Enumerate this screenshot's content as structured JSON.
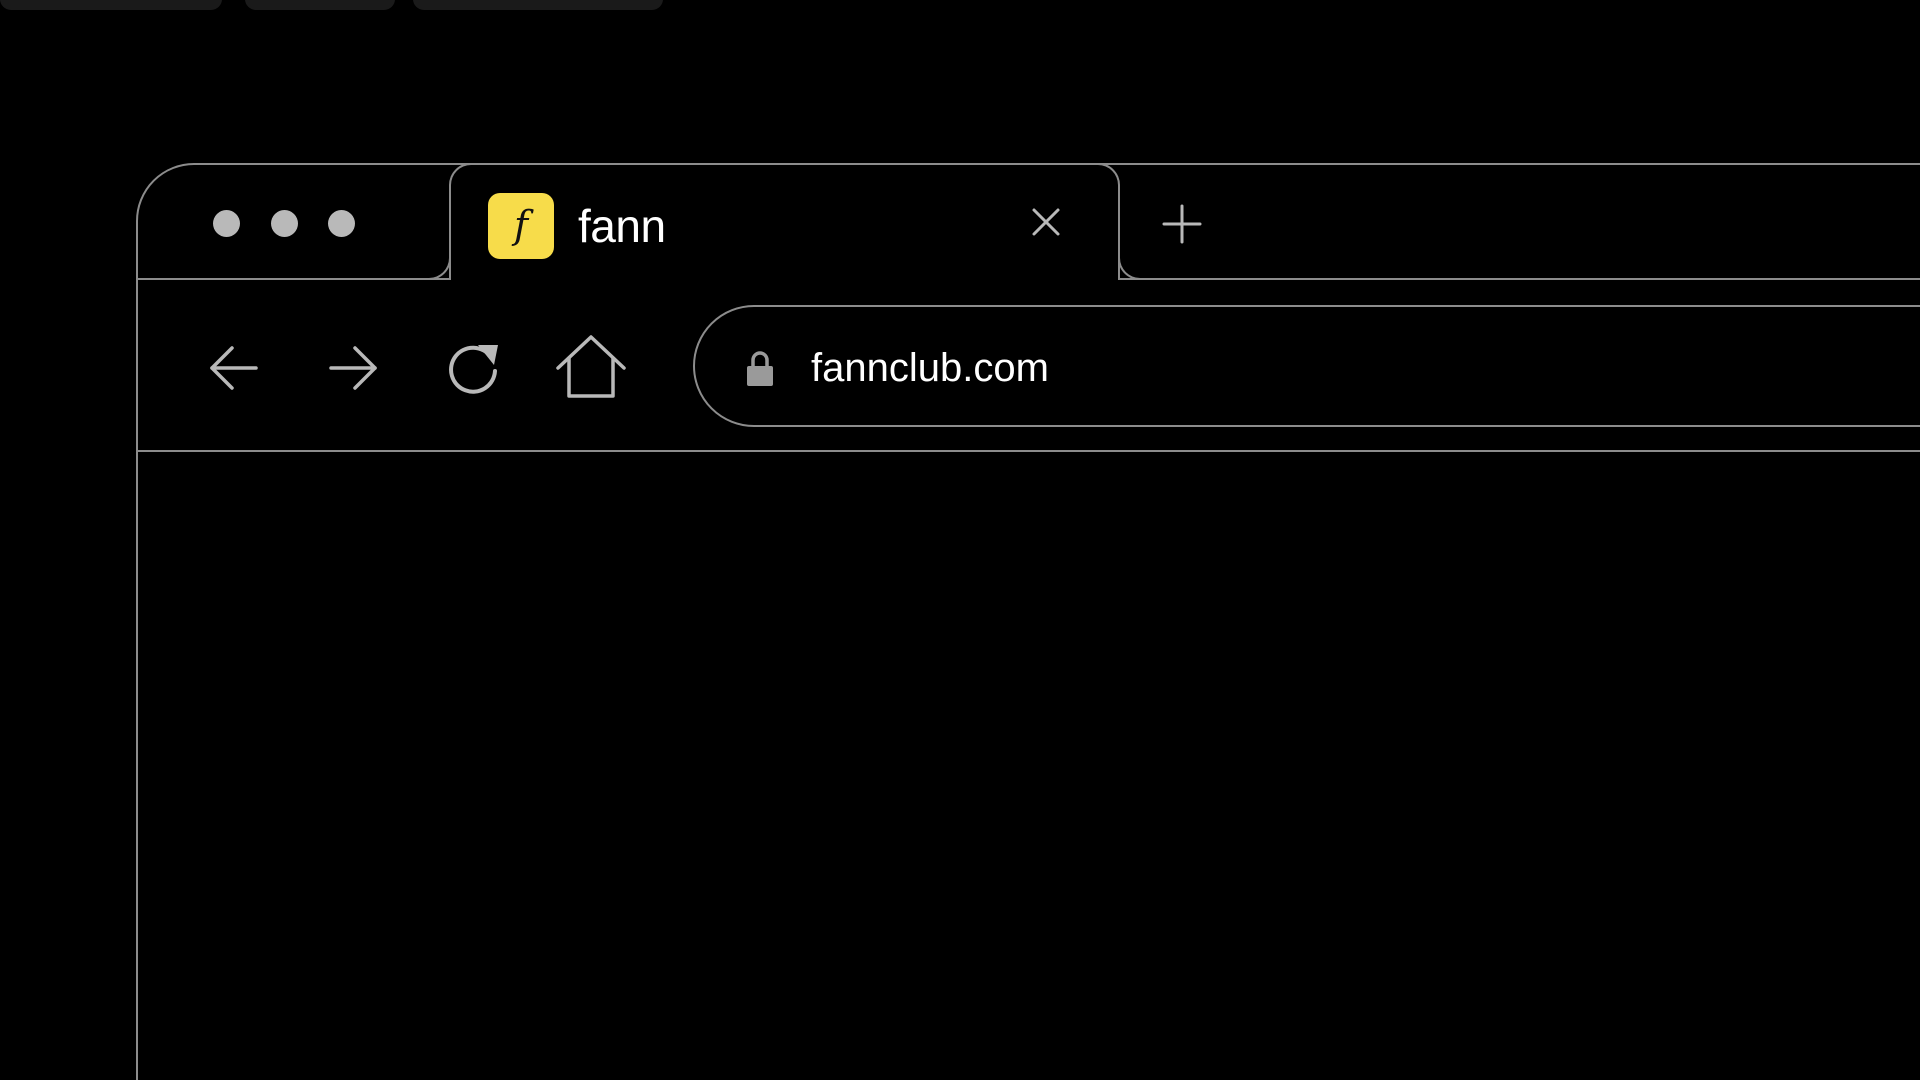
{
  "tab": {
    "title": "fann",
    "favicon_letter": "f",
    "favicon_color": "#f7dc4a",
    "close_icon": "close-icon"
  },
  "toolbar": {
    "new_tab_icon": "plus-icon",
    "back_icon": "arrow-left-icon",
    "forward_icon": "arrow-right-icon",
    "reload_icon": "reload-icon",
    "home_icon": "home-icon"
  },
  "address_bar": {
    "url": "fannclub.com",
    "lock_icon": "lock-icon"
  },
  "colors": {
    "background": "#000000",
    "outline": "#8c8c8c",
    "window_dots": "#b9b9b9",
    "text": "#ffffff"
  }
}
